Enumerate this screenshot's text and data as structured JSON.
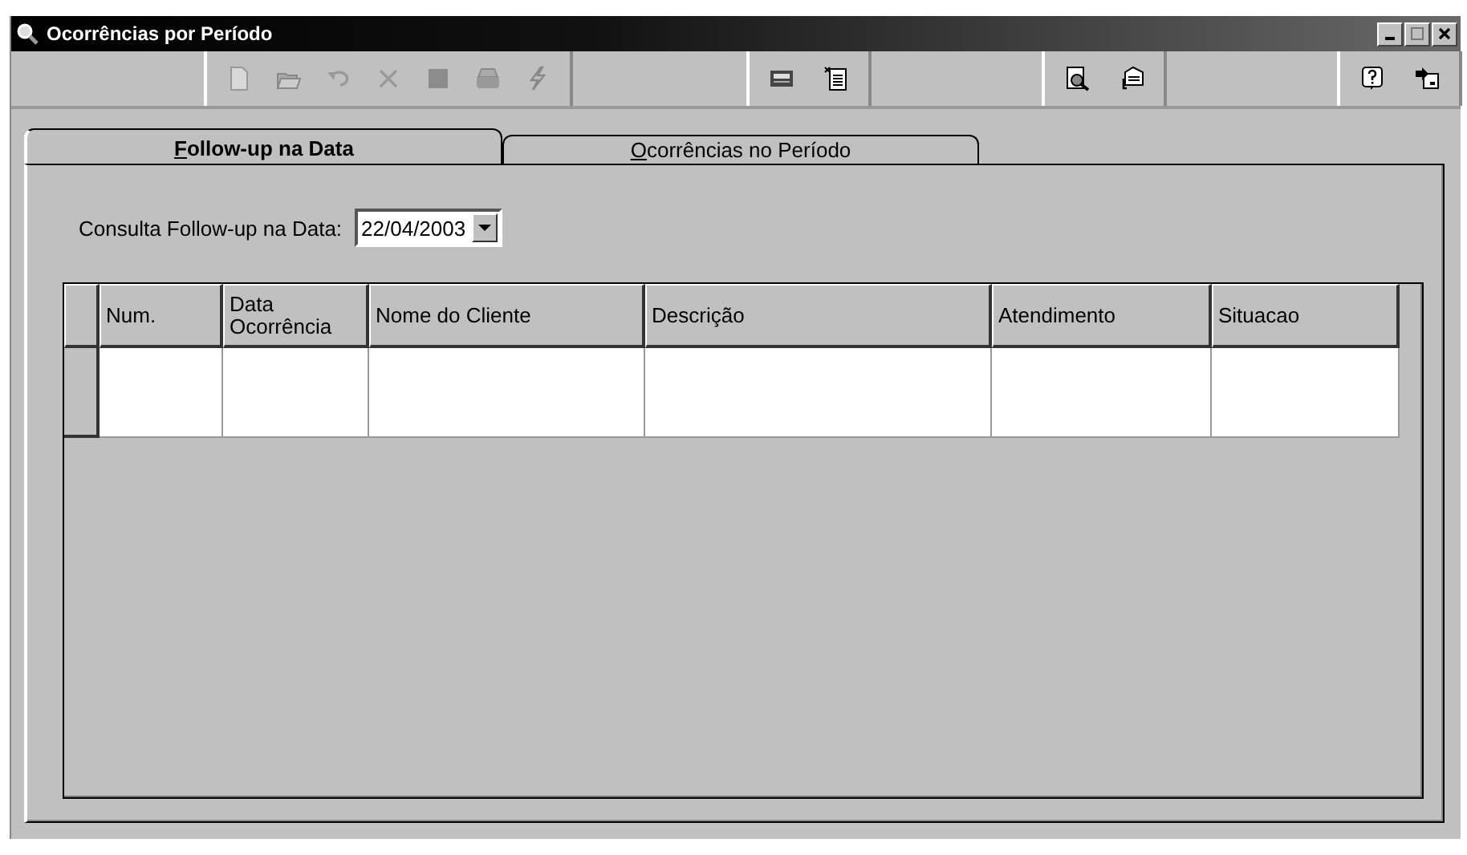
{
  "window": {
    "title": "Ocorrências por Período"
  },
  "tabs": [
    {
      "accel": "F",
      "rest": "ollow-up na Data",
      "selected": true
    },
    {
      "accel": "O",
      "rest": "corrências no Período",
      "selected": false
    }
  ],
  "query": {
    "label": "Consulta Follow-up na Data:",
    "value": "22/04/2003"
  },
  "table": {
    "columns": [
      "Num.",
      "Data Ocorrência",
      "Nome do Cliente",
      "Descrição",
      "Atendimento",
      "Situacao"
    ]
  }
}
